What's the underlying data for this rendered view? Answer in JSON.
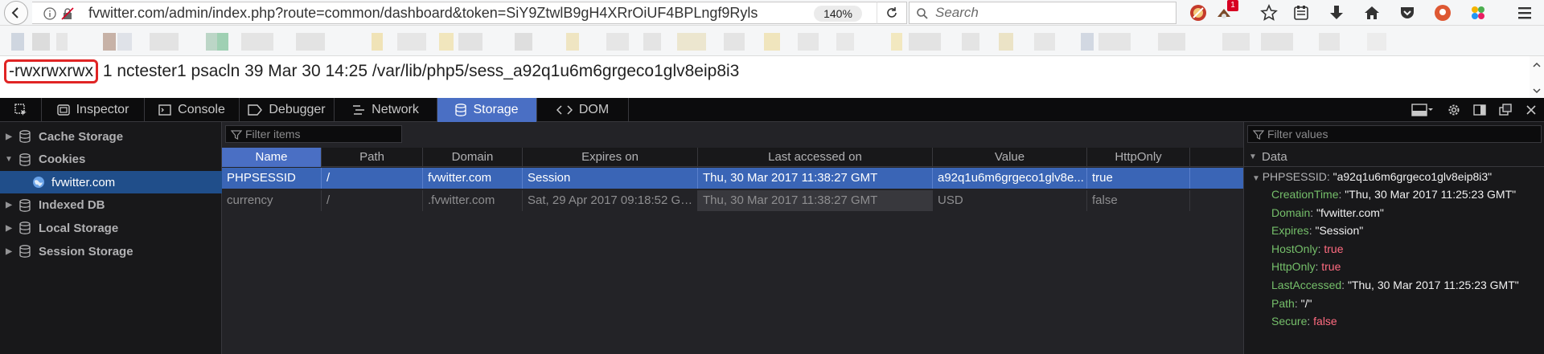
{
  "browser": {
    "url": "fvwitter.com/admin/index.php?route=common/dashboard&token=SiY9ZtwlB9gH4XRrOiUF4BPLngf9Ryls",
    "zoom": "140%",
    "search_placeholder": "Search",
    "notification_count": "1",
    "toolbar_icons": [
      "ublock-icon",
      "extension-icon",
      "star-bookmark-icon",
      "reading-list-icon",
      "download-icon",
      "home-icon",
      "pocket-icon",
      "duckduckgo-icon",
      "flower-extension-icon",
      "menu-icon"
    ]
  },
  "page": {
    "permissions": "-rwxrwxrwx",
    "line_rest": "1 nctester1 psacln 39 Mar 30 14:25 /var/lib/php5/sess_a92q1u6m6grgeco1glv8eip8i3"
  },
  "devtools": {
    "tabs": [
      {
        "label": "Inspector",
        "icon": "inspector-icon"
      },
      {
        "label": "Console",
        "icon": "console-icon"
      },
      {
        "label": "Debugger",
        "icon": "debugger-icon"
      },
      {
        "label": "Network",
        "icon": "network-icon"
      },
      {
        "label": "Storage",
        "icon": "storage-icon",
        "active": true
      },
      {
        "label": "DOM",
        "icon": "dom-icon"
      }
    ],
    "sidebar": {
      "items": [
        {
          "label": "Cache Storage",
          "expanded": false
        },
        {
          "label": "Cookies",
          "expanded": true
        },
        {
          "label": "fvwitter.com",
          "child": true,
          "selected": true
        },
        {
          "label": "Indexed DB",
          "expanded": false
        },
        {
          "label": "Local Storage",
          "expanded": false
        },
        {
          "label": "Session Storage",
          "expanded": false
        }
      ]
    },
    "filter_placeholder": "Filter items",
    "table": {
      "columns": [
        "Name",
        "Path",
        "Domain",
        "Expires on",
        "Last accessed on",
        "Value",
        "HttpOnly"
      ],
      "sorted_column": "Name",
      "rows": [
        [
          "PHPSESSID",
          "/",
          "fvwitter.com",
          "Session",
          "Thu, 30 Mar 2017 11:38:27 GMT",
          "a92q1u6m6grgeco1glv8e...",
          "true"
        ],
        [
          "currency",
          "/",
          ".fvwitter.com",
          "Sat, 29 Apr 2017 09:18:52 GMT",
          "Thu, 30 Mar 2017 11:38:27 GMT",
          "USD",
          "false"
        ]
      ]
    },
    "values_filter_placeholder": "Filter values",
    "data_panel": {
      "header": "Data",
      "root_key": "PHPSESSID",
      "root_value": "\"a92q1u6m6grgeco1glv8eip8i3\"",
      "props": [
        {
          "key": "CreationTime",
          "value": "\"Thu, 30 Mar 2017 11:25:23 GMT\"",
          "kind": "string"
        },
        {
          "key": "Domain",
          "value": "\"fvwitter.com\"",
          "kind": "string"
        },
        {
          "key": "Expires",
          "value": "\"Session\"",
          "kind": "string"
        },
        {
          "key": "HostOnly",
          "value": "true",
          "kind": "bool"
        },
        {
          "key": "HttpOnly",
          "value": "true",
          "kind": "bool"
        },
        {
          "key": "LastAccessed",
          "value": "\"Thu, 30 Mar 2017 11:25:23 GMT\"",
          "kind": "string"
        },
        {
          "key": "Path",
          "value": "\"/\"",
          "kind": "string"
        },
        {
          "key": "Secure",
          "value": "false",
          "kind": "bool"
        }
      ]
    }
  },
  "colors": {
    "active_tab": "#4a6fc4",
    "selected_row": "#3a65b6",
    "highlight_box": "#e02424",
    "prop_key": "#75bf6a",
    "bool_value": "#ff6b80"
  }
}
